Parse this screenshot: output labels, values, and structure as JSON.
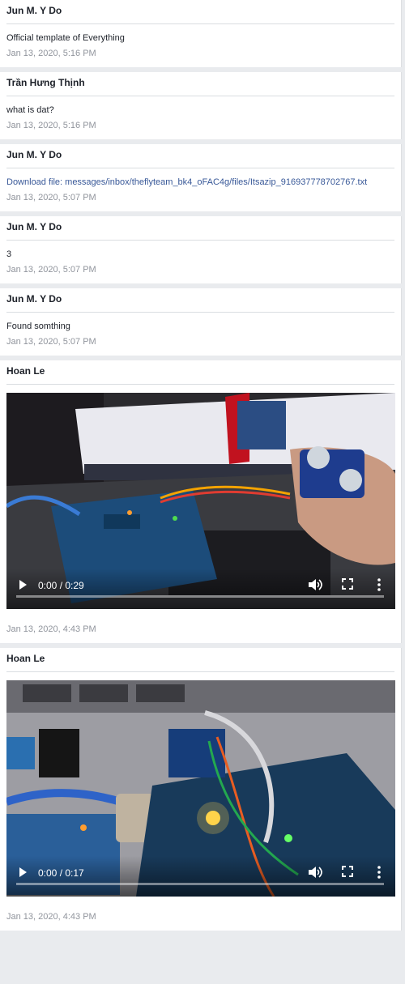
{
  "messages": [
    {
      "sender": "Jun M. Y Do",
      "text": "Official template of Everything",
      "time": "Jan 13, 2020, 5:16 PM"
    },
    {
      "sender": "Trần Hưng Thịnh",
      "text": "what is dat?",
      "time": "Jan 13, 2020, 5:16 PM"
    },
    {
      "sender": "Jun M. Y Do",
      "link": "Download file: messages/inbox/theflyteam_bk4_oFAC4g/files/Itsazip_916937778702767.txt",
      "time": "Jan 13, 2020, 5:07 PM"
    },
    {
      "sender": "Jun M. Y Do",
      "text": "3",
      "time": "Jan 13, 2020, 5:07 PM"
    },
    {
      "sender": "Jun M. Y Do",
      "text": "Found somthing",
      "time": "Jan 13, 2020, 5:07 PM"
    }
  ],
  "videos": [
    {
      "sender": "Hoan Le",
      "time_readout": "0:00 / 0:29",
      "progress": 0,
      "time": "Jan 13, 2020, 4:43 PM"
    },
    {
      "sender": "Hoan Le",
      "time_readout": "0:00 / 0:17",
      "progress": 0,
      "time": "Jan 13, 2020, 4:43 PM"
    }
  ],
  "icons": {
    "play": "play-icon",
    "volume": "volume-icon",
    "fullscreen": "fullscreen-icon",
    "more": "more-options-icon"
  },
  "colors": {
    "link": "#385898",
    "timestamp": "#90949c",
    "background": "#e9ebee"
  }
}
